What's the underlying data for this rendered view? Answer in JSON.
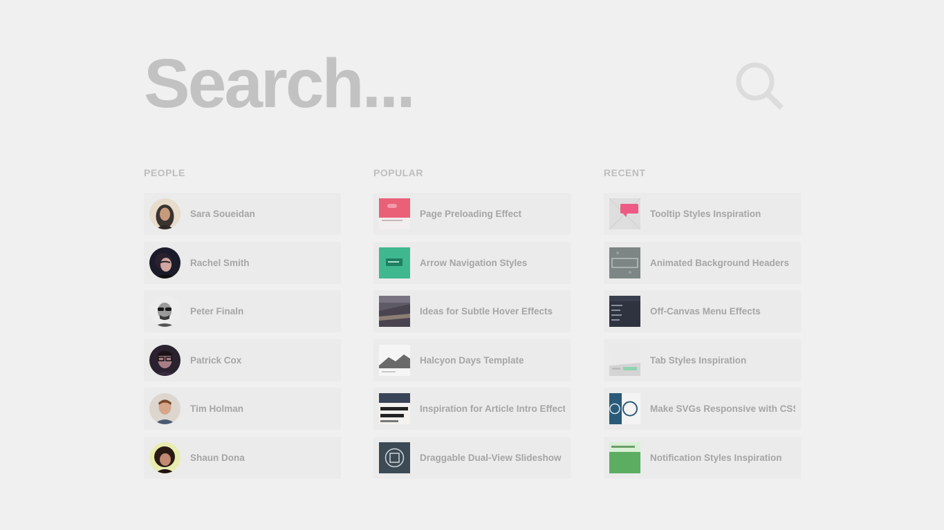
{
  "search": {
    "placeholder": "Search...",
    "value": ""
  },
  "colors": {
    "background": "#f0f0f0",
    "item_background": "#ebebeb",
    "title_text": "#bdbdbd",
    "item_text": "#a5a5a5",
    "search_text": "#c2c2c2"
  },
  "columns": [
    {
      "title": "PEOPLE",
      "items": [
        {
          "label": "Sara Soueidan",
          "icon": "avatar"
        },
        {
          "label": "Rachel Smith",
          "icon": "avatar"
        },
        {
          "label": "Peter Finaln",
          "icon": "avatar"
        },
        {
          "label": "Patrick Cox",
          "icon": "avatar"
        },
        {
          "label": "Tim Holman",
          "icon": "avatar"
        },
        {
          "label": "Shaun Dona",
          "icon": "avatar"
        }
      ]
    },
    {
      "title": "POPULAR",
      "items": [
        {
          "label": "Page Preloading Effect",
          "icon": "thumbnail"
        },
        {
          "label": "Arrow Navigation Styles",
          "icon": "thumbnail"
        },
        {
          "label": "Ideas for Subtle Hover Effects",
          "icon": "thumbnail"
        },
        {
          "label": "Halcyon Days Template",
          "icon": "thumbnail"
        },
        {
          "label": "Inspiration for Article Intro Effects",
          "icon": "thumbnail"
        },
        {
          "label": "Draggable Dual-View Slideshow",
          "icon": "thumbnail"
        }
      ]
    },
    {
      "title": "RECENT",
      "items": [
        {
          "label": "Tooltip Styles Inspiration",
          "icon": "thumbnail"
        },
        {
          "label": "Animated Background Headers",
          "icon": "thumbnail"
        },
        {
          "label": "Off-Canvas Menu Effects",
          "icon": "thumbnail"
        },
        {
          "label": "Tab Styles Inspiration",
          "icon": "thumbnail"
        },
        {
          "label": "Make SVGs Responsive with CSS",
          "icon": "thumbnail"
        },
        {
          "label": "Notification Styles Inspiration",
          "icon": "thumbnail"
        }
      ]
    }
  ]
}
